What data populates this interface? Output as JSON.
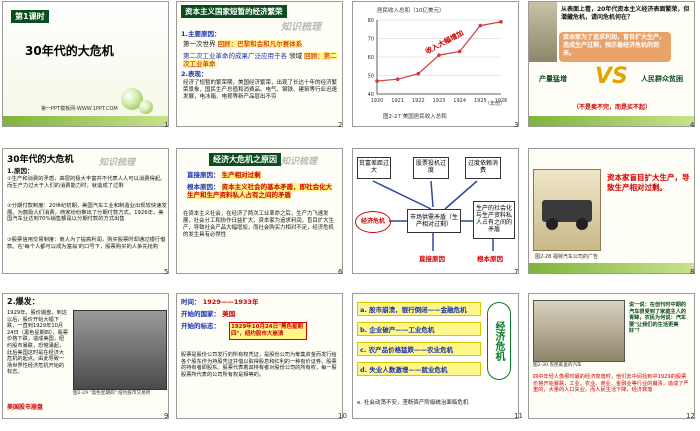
{
  "s1": {
    "num": "1",
    "lesson": "第1课时",
    "title": "30年代的大危机",
    "site": "第一PPT模板网-WWW.1PPT.COM"
  },
  "s2": {
    "num": "2",
    "header": "资本主义国家短暂的经济繁荣",
    "wm": "知识梳理",
    "l1": "1.主要原因：",
    "l2a": "第一次世界",
    "l2b": "回顾：巴黎和会和凡尔赛体系",
    "l3a": "第二次工业革命的成果广泛应用于各",
    "l3b": "领域",
    "l3c": "回顾：第二次工业革命",
    "l4": "2.表现：",
    "l5": "经济了短暂的繁荣期，美国经济繁荣，出现了长达十年的经济繁荣景象，国民生产总值和消费品、电气、钢铁、建筑等行业迅速发展，电冰箱、电视等新产品层出不穷"
  },
  "s3": {
    "num": "3",
    "ylabel": "居民收入总和（10亿美元）",
    "xlabel": "（年份）",
    "caption": "图2-27 美国居民收入总和",
    "annot": "收入大幅增加",
    "chart_data": {
      "type": "line",
      "x": [
        "1920",
        "1921",
        "1922",
        "1923",
        "1924",
        "1925",
        "1926"
      ],
      "values": [
        47,
        48,
        51,
        61,
        63,
        77,
        79
      ],
      "ylim": [
        40,
        80
      ],
      "ylabel": "居民收入总和（10亿美元）",
      "xlabel": "（年份）",
      "title": "图2-27 美国居民收入总和"
    }
  },
  "s4": {
    "num": "4",
    "q": "从表面上看，20年代资本主义经济表面繁荣，但潜藏危机，请问危机何在？",
    "box1": "资本家为了追求利润，盲目扩大生产，造成生产过剩，预示着经济危机的到来。",
    "left": "产量猛增",
    "vs": "VS",
    "right": "人民群众贫困",
    "bottom": "（不是卖不完，而是买不起）"
  },
  "s5": {
    "num": "5",
    "title": "30年代的大危机",
    "wm": "知识梳理",
    "l1": "1.原因：",
    "l2": "①生产和消费的矛盾，高层的极大丰富并不代表人人可以消费得起。而生产力过大于人们的消费能力时，就造成了过剩",
    "l3": "②分期付款制度：20世纪初期，美国汽车工业和制造业出现较快速发展。为鼓励人们消费，商家纷纷推出了分期付款方式。1926年，美国汽车业达到70%销售额是以分期付款的方式出售",
    "l4": "③股票信用交易制度：商人为了提高利润，购买股票时却通过银行借款。在'每个人都可以成为富翁'的口号下，股票购买的人争先抢购"
  },
  "s6": {
    "num": "6",
    "header": "经济大危机之原因",
    "wm": "知识梳理",
    "d": "直接原因：",
    "dv": "生产相对过剩",
    "r": "根本原因：",
    "rv": "资本主义社会的基本矛盾，即社会化大生产和生产资料私人占有之间的矛盾",
    "body": "在资本主义社会，在经济了两次工业革命之后，生产力飞速发展，社会分工和协作日益扩大，资本家为追求利润，盲目扩大生产，导致社会产品大幅增加，而社会购买力相对不足，经济危机的发生具有必然性"
  },
  "s7": {
    "num": "7",
    "b1": "贫富差距过大",
    "b2": "股票投机过度",
    "b3": "过度依赖消费",
    "c1": "市场供需矛盾（生产相对过剩）",
    "c2": "生产的社会化与生产资料私人占有之间的矛盾",
    "e": "经济危机",
    "d": "直接原因",
    "r": "根本原因"
  },
  "s8": {
    "num": "8",
    "caption": "图2-28 福特汽车公司的广告",
    "text": "资本家盲目扩大生产，导致生产相对过剩。"
  },
  "s9": {
    "num": "9",
    "l1": "2.爆发：",
    "l2": "1929年，股价崩盘，到这以后，股价开始大幅下跌，一直到1929年10月24日（黑色星期四），股票价格下跌，造成美国，纽约股市暴跌，恐慌涌起，此后美国这时是在经济大危机的起点。由此导致一场世界性经济危机开始的标志。",
    "l3": "美国股市崩盘",
    "caption": "图2-29 \"黑色星期四\" 纽约股市交易所"
  },
  "s10": {
    "num": "10",
    "t1": "时间：",
    "t1v": "1929——1933年",
    "t2": "开始的国家：",
    "t2v": "美国",
    "t3": "开始的标志：",
    "t3v": "1929年10月24日\"黑色星期四\"，纽约股市大崩溃",
    "body": "股票是股份公司发行的所有权凭证，是股份公司为筹集资金而发行给各个股东作为持股凭证并借以取得股息和红利的一种有价证券。股票的持有者即股东。股票代表着其持有者对股份公司的所有权，每一股股票所代表的公司所有权是相等的。"
  },
  "s11": {
    "num": "11",
    "a": "a. 股市崩溃，银行倒闭——金融危机",
    "b": "b. 企业破产——工业危机",
    "c": "c. 农产品价格猛跌——农业危机",
    "d": "d. 失业人数激增——就业危机",
    "e": "e. 社会动荡不安，垄断资产阶级统治面临危机",
    "side": "经济危机"
  },
  "s12": {
    "num": "12",
    "caption": "图2-30 农民家里的汽车",
    "quote": "说一说：在创刊时中期的汽车很受到了家庭主人的青睐，农民为何说：汽车要\"让我们的生活更美好\"？",
    "body": "四中年轻人像那时最的经济衰落时，他们去中间找到中1929的股票价格开始暴跌，工业、农业、商业、金融业等行业的崩溃，造成了严重的，大量的人口失业，而人民生活下降，经济衰落"
  }
}
